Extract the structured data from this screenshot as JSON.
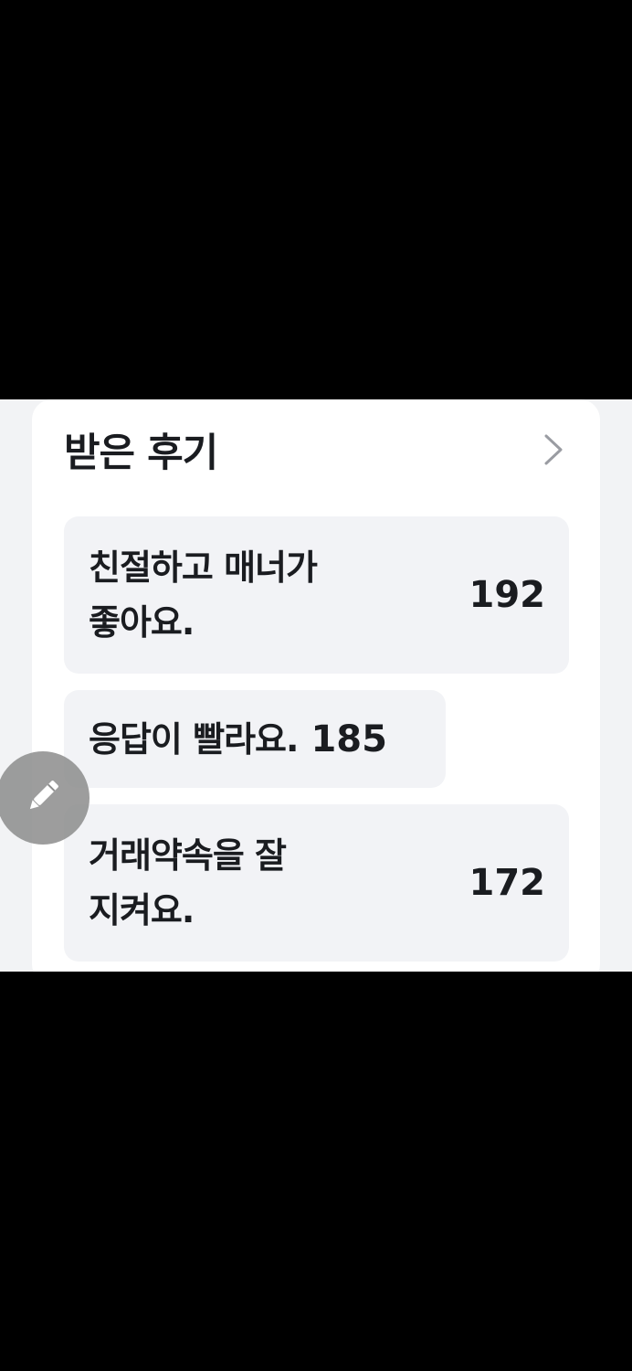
{
  "section": {
    "title": "받은 후기",
    "chevron_icon": "chevron-right-icon"
  },
  "reviews": [
    {
      "label_line1": "친절하고 매너가",
      "label_line2": "좋아요.",
      "count": "192"
    },
    {
      "label": "응답이 빨라요.",
      "count": "185"
    },
    {
      "label_line1": "거래약속을 잘",
      "label_line2": "지켜요.",
      "count": "172"
    }
  ],
  "fab": {
    "icon": "pencil-icon"
  },
  "colors": {
    "background": "#f2f3f5",
    "card": "#ffffff",
    "chip": "#f2f3f6",
    "text": "#1a1c20",
    "fab": "#8c8c8c"
  }
}
